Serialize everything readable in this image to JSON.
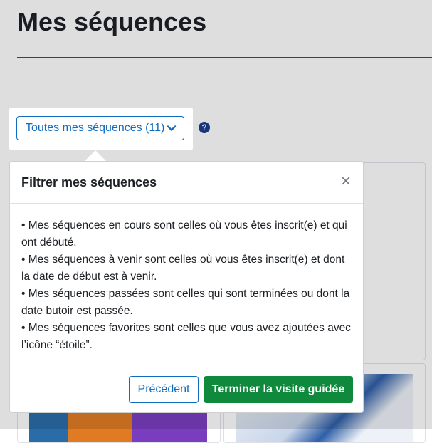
{
  "page": {
    "title": "Mes séquences"
  },
  "filter": {
    "label": "Toutes mes séquences (11)"
  },
  "help": {
    "glyph": "?"
  },
  "card": {
    "favorite_glyph": "☆"
  },
  "tour": {
    "title": "Filtrer mes séquences",
    "close_glyph": "×",
    "body": [
      "• Mes séquences en cours sont celles où vous êtes inscrit(e) et qui ont débuté.",
      "• Mes séquences à venir sont celles où vous êtes inscrit(e) et dont la date de début est à venir.",
      "• Mes séquences passées sont celles qui sont terminées ou dont la date butoir est passée.",
      "• Mes séquences favorites sont celles que vous avez ajoutées avec l’icône “étoile”."
    ],
    "previous_label": "Précédent",
    "end_label": "Terminer la visite guidée"
  },
  "colors": {
    "primary": "#0f6cbf",
    "success": "#0f8a3c",
    "title_underline": "#0f6d3a",
    "help_icon": "#1a3e8c"
  },
  "icons": [
    "help-icon",
    "chevron-down-icon",
    "close-icon",
    "star-icon"
  ]
}
